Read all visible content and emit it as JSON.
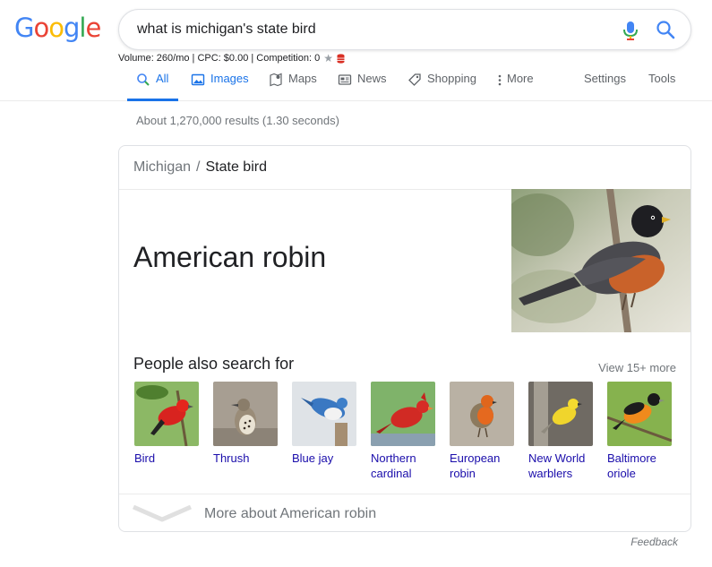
{
  "logo": {
    "letters": [
      "G",
      "o",
      "o",
      "g",
      "l",
      "e"
    ],
    "colors": [
      "#4285f4",
      "#ea4335",
      "#fbbc05",
      "#4285f4",
      "#34a853",
      "#ea4335"
    ]
  },
  "search": {
    "query": "what is michigan's state bird",
    "mic_icon": "microphone-icon",
    "search_icon": "search-icon"
  },
  "keyword_stats": {
    "text": "Volume: 260/mo | CPC: $0.00 | Competition: 0",
    "star_icon": "star-icon",
    "db_icon": "database-icon"
  },
  "tabs": {
    "all": "All",
    "images": "Images",
    "maps": "Maps",
    "news": "News",
    "shopping": "Shopping",
    "more": "More",
    "settings": "Settings",
    "tools": "Tools"
  },
  "results_stats": "About 1,270,000 results (1.30 seconds)",
  "knowledge_panel": {
    "breadcrumb": {
      "parent": "Michigan",
      "separator": "/",
      "current": "State bird"
    },
    "answer": "American robin",
    "people_also_search_for": "People also search for",
    "view_more": "View 15+ more",
    "related": [
      {
        "line1": "Bird",
        "line2": "",
        "icon": "red-bird-image"
      },
      {
        "line1": "Thrush",
        "line2": "",
        "icon": "thrush-image"
      },
      {
        "line1": "Blue jay",
        "line2": "",
        "icon": "blue-jay-image"
      },
      {
        "line1": "Northern",
        "line2": "cardinal",
        "icon": "cardinal-image"
      },
      {
        "line1": "European",
        "line2": "robin",
        "icon": "european-robin-image"
      },
      {
        "line1": "New World",
        "line2": "warblers",
        "icon": "warbler-image"
      },
      {
        "line1": "Baltimore",
        "line2": "oriole",
        "icon": "oriole-image"
      }
    ],
    "more_about": "More about American robin"
  },
  "feedback": "Feedback",
  "colors": {
    "accent": "#1a73e8",
    "link": "#1a0dab",
    "muted": "#70757a"
  }
}
